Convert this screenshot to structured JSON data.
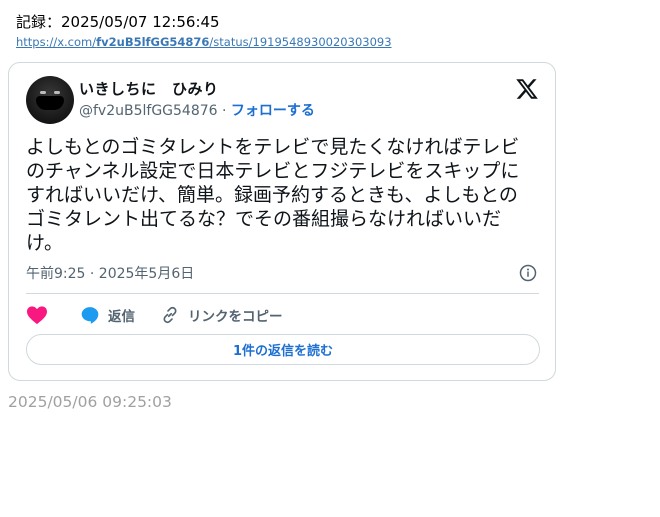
{
  "record": {
    "label": "記録：2025/05/07 12:56:45"
  },
  "link": {
    "prefix": "https://x.com/",
    "user": "fv2uB5lfGG54876",
    "suffix": "/status/1919548930020303093"
  },
  "tweet": {
    "display_name": "いきしちに　ひみり",
    "handle": "@fv2uB5lfGG54876",
    "separator": " · ",
    "follow_label": "フォローする",
    "text": "よしもとのゴミタレントをテレビで見たくなければテレビのチャンネル設定で日本テレビとフジテレビをスキップにすればいいだけ、簡単。録画予約するときも、よしもとのゴミタレント出てるな？でその番組撮らなければいいだけ。",
    "timestamp": "午前9:25 · 2025年5月6日",
    "reply_label": "返信",
    "copy_link_label": "リンクをコピー",
    "read_replies_label": "1件の返信を読む"
  },
  "footer": {
    "date": "2025/05/06 09:25:03"
  },
  "colors": {
    "accent": "#1d6fd1",
    "heart": "#f91880",
    "reply_bubble": "#1d9bf0",
    "muted": "#536471"
  },
  "icons": [
    "x-logo-icon",
    "info-icon",
    "heart-icon",
    "reply-icon",
    "link-icon"
  ]
}
